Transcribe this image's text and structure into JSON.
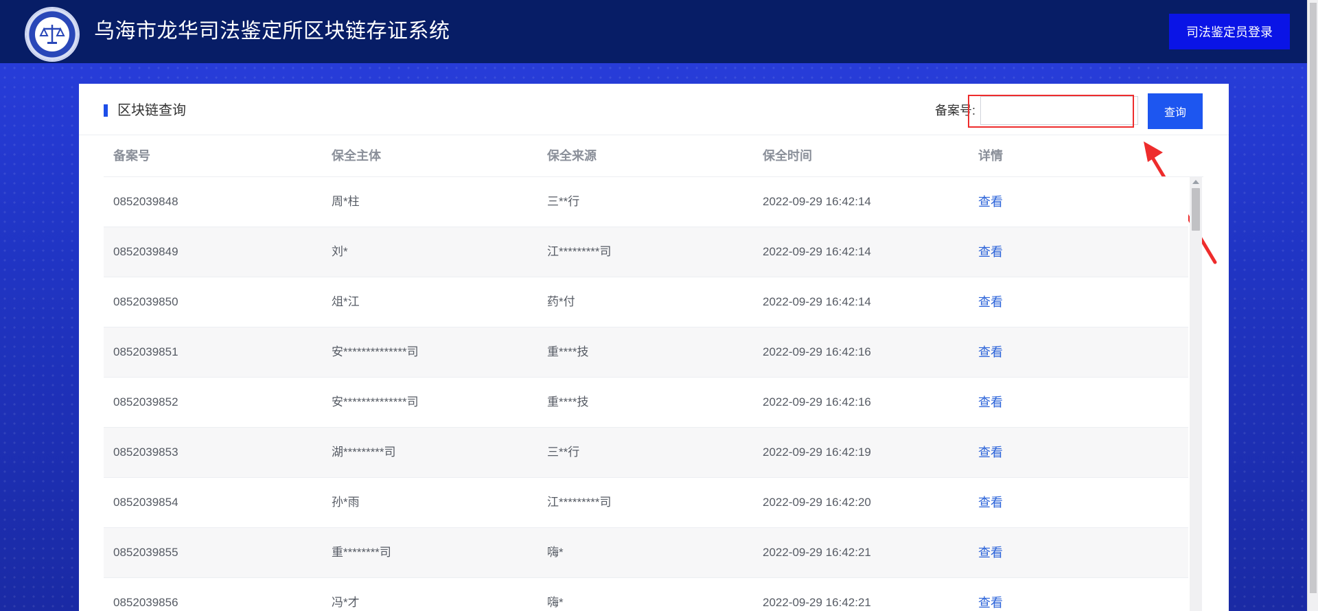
{
  "header": {
    "title": "乌海市龙华司法鉴定所区块链存证系统",
    "login_label": "司法鉴定员登录",
    "logo_icon": "judicial-scales-emblem-icon"
  },
  "panel": {
    "title": "区块链查询",
    "search": {
      "label": "备案号:",
      "value": "",
      "placeholder": "",
      "button_label": "查询"
    }
  },
  "table": {
    "columns": [
      "备案号",
      "保全主体",
      "保全来源",
      "保全时间",
      "详情"
    ],
    "rows": [
      {
        "id": "0852039848",
        "subject": "周*柱",
        "source": "三**行",
        "time": "2022-09-29 16:42:14",
        "detail": "查看"
      },
      {
        "id": "0852039849",
        "subject": "刘*",
        "source": "江*********司",
        "time": "2022-09-29 16:42:14",
        "detail": "查看"
      },
      {
        "id": "0852039850",
        "subject": "俎*江",
        "source": "药*付",
        "time": "2022-09-29 16:42:14",
        "detail": "查看"
      },
      {
        "id": "0852039851",
        "subject": "安**************司",
        "source": "重****技",
        "time": "2022-09-29 16:42:16",
        "detail": "查看"
      },
      {
        "id": "0852039852",
        "subject": "安**************司",
        "source": "重****技",
        "time": "2022-09-29 16:42:16",
        "detail": "查看"
      },
      {
        "id": "0852039853",
        "subject": "湖*********司",
        "source": "三**行",
        "time": "2022-09-29 16:42:19",
        "detail": "查看"
      },
      {
        "id": "0852039854",
        "subject": "孙*雨",
        "source": "江*********司",
        "time": "2022-09-29 16:42:20",
        "detail": "查看"
      },
      {
        "id": "0852039855",
        "subject": "重********司",
        "source": "嗨*",
        "time": "2022-09-29 16:42:21",
        "detail": "查看"
      },
      {
        "id": "0852039856",
        "subject": "冯*才",
        "source": "嗨*",
        "time": "2022-09-29 16:42:21",
        "detail": "查看"
      }
    ]
  },
  "annotation": {
    "highlight_color": "#ee2c2c",
    "arrow_icon": "red-pointer-arrow-icon"
  },
  "colors": {
    "header_bg": "#071d66",
    "login_button": "#0a14e6",
    "query_button": "#1d56f0",
    "accent": "#1d4ee8",
    "link": "#2b63d9"
  }
}
